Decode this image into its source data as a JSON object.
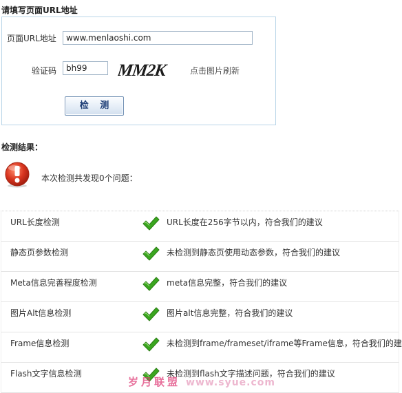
{
  "form_section": {
    "title": "请填写页面URL地址",
    "url_label": "页面URL地址",
    "url_value": "www.menlaoshi.com",
    "captcha_label": "验证码",
    "captcha_value": "bh99",
    "captcha_image_text": "MM2K",
    "refresh_hint": "点击图片刷新",
    "check_button": "检 测"
  },
  "result_section": {
    "title": "检测结果：",
    "summary": "本次检测共发现0个问题："
  },
  "results": [
    {
      "name": "URL长度检测",
      "status": "pass",
      "detail": "URL长度在256字节以内，符合我们的建议"
    },
    {
      "name": "静态页参数检测",
      "status": "pass",
      "detail": "未检测到静态页使用动态参数，符合我们的建议"
    },
    {
      "name": "Meta信息完善程度检测",
      "status": "pass",
      "detail": "meta信息完整，符合我们的建议"
    },
    {
      "name": "图片Alt信息检测",
      "status": "pass",
      "detail": "图片alt信息完整，符合我们的建议"
    },
    {
      "name": "Frame信息检测",
      "status": "pass",
      "detail": "未检测到frame/frameset/iframe等Frame信息，符合我们的建议"
    },
    {
      "name": "Flash文字信息检测",
      "status": "pass",
      "detail": "未检测到flash文字描述问题，符合我们的建议"
    }
  ],
  "watermark": {
    "brand": "岁月联盟",
    "url": "www.syue.com"
  },
  "colors": {
    "check_green": "#3aa61f",
    "alert_red": "#d8351f",
    "form_border": "#b7d4e8",
    "button_text": "#1f3f77"
  },
  "icons": {
    "status_pass": "green-checkmark-icon",
    "summary": "red-exclamation-icon"
  }
}
